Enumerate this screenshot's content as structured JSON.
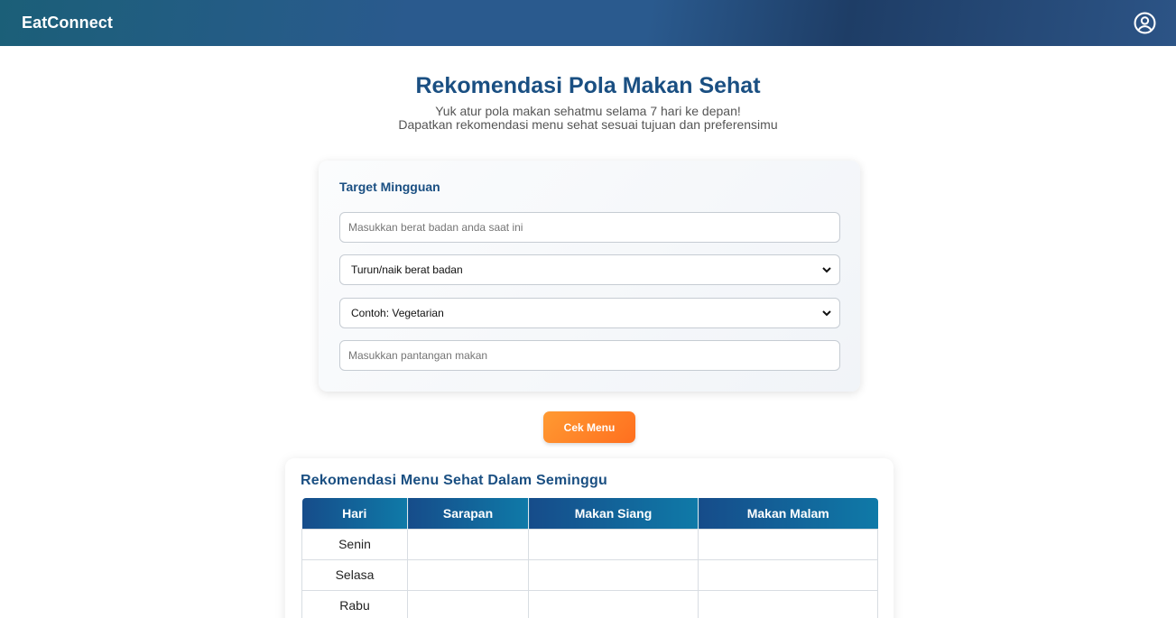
{
  "navbar": {
    "brand": "EatConnect",
    "profile_icon": "user-circle-icon"
  },
  "hero": {
    "title": "Rekomendasi Pola Makan Sehat",
    "subtitle_line1": "Yuk atur pola makan sehatmu selama 7 hari ke depan!",
    "subtitle_line2": "Dapatkan rekomendasi menu sehat sesuai tujuan dan preferensimu"
  },
  "form": {
    "title": "Target Mingguan",
    "weight_input": {
      "placeholder": "Masukkan berat badan anda saat ini",
      "value": ""
    },
    "goal_select": {
      "selected": "Turun/naik berat badan"
    },
    "diet_select": {
      "selected": "Contoh: Vegetarian"
    },
    "restriction_input": {
      "placeholder": "Masukkan pantangan makan",
      "value": ""
    },
    "submit_label": "Cek Menu"
  },
  "result": {
    "title": "Rekomendasi Menu Sehat Dalam Seminggu",
    "columns": [
      "Hari",
      "Sarapan",
      "Makan Siang",
      "Makan Malam"
    ],
    "rows": [
      [
        "Senin",
        "",
        "",
        ""
      ],
      [
        "Selasa",
        "",
        "",
        ""
      ],
      [
        "Rabu",
        "",
        "",
        ""
      ]
    ]
  },
  "colors": {
    "primary": "#1a4f82",
    "accent": "#ff8a2a",
    "header_gradient_start": "#164c8a",
    "header_gradient_end": "#0f7aa8"
  }
}
